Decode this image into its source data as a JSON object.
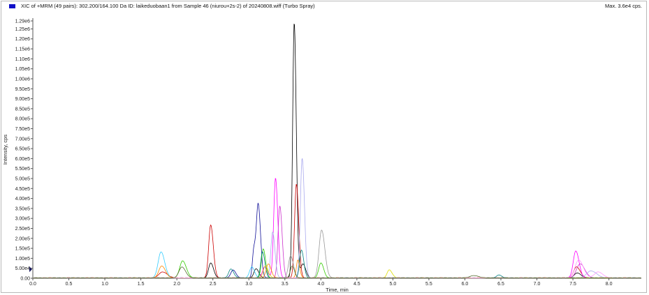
{
  "header": {
    "title": "XIC of +MRM (49 pairs): 302.200/164.100 Da ID: laikeduobaan1 from Sample 46 (niurou+2s-2) of 20240808.wiff (Turbo Spray)",
    "max_label": "Max. 3.6e4 cps."
  },
  "chart_data": {
    "type": "line",
    "xlabel": "Time, min",
    "ylabel": "Intensity, cps",
    "xlim": [
      0.0,
      8.45
    ],
    "ylim": [
      0,
      1290000
    ],
    "x_ticks": [
      0.0,
      0.5,
      1.0,
      1.5,
      2.0,
      2.5,
      3.0,
      3.5,
      4.0,
      4.5,
      5.0,
      5.5,
      6.0,
      6.5,
      7.0,
      7.5,
      8.0
    ],
    "x_tick_labels": [
      "0.0",
      "0.5",
      "1.0",
      "1.5",
      "2.0",
      "2.5",
      "3.0",
      "3.5",
      "4.0",
      "4.5",
      "5.0",
      "5.5",
      "6.0",
      "6.5",
      "7.0",
      "7.5",
      "8.0"
    ],
    "y_ticks": [
      0,
      50000,
      100000,
      150000,
      200000,
      250000,
      300000,
      350000,
      400000,
      450000,
      500000,
      550000,
      600000,
      650000,
      700000,
      750000,
      800000,
      850000,
      900000,
      950000,
      1000000,
      1050000,
      1100000,
      1150000,
      1200000,
      1250000,
      1290000
    ],
    "y_tick_labels": [
      "0.00",
      "5.00e4",
      "1.00e5",
      "1.50e5",
      "2.00e5",
      "2.50e5",
      "3.00e5",
      "3.50e5",
      "4.00e5",
      "4.50e5",
      "5.00e5",
      "5.50e5",
      "6.00e5",
      "6.50e5",
      "7.00e5",
      "7.50e5",
      "8.00e5",
      "8.50e5",
      "9.00e5",
      "9.50e5",
      "1.00e6",
      "1.05e6",
      "1.10e6",
      "1.15e6",
      "1.20e6",
      "1.25e6",
      "1.29e6"
    ],
    "grid": false,
    "series": [
      {
        "color": "#000000",
        "peaks": [
          [
            3.63,
            1280000,
            0.022
          ],
          [
            2.47,
            75000,
            0.03
          ],
          [
            3.1,
            45000,
            0.03
          ],
          [
            3.75,
            70000,
            0.03
          ],
          [
            7.56,
            25000,
            0.04
          ]
        ]
      },
      {
        "color": "#cc0000",
        "peaks": [
          [
            2.47,
            265000,
            0.028
          ],
          [
            3.66,
            470000,
            0.025
          ],
          [
            7.55,
            55000,
            0.04
          ],
          [
            1.8,
            30000,
            0.05
          ]
        ]
      },
      {
        "color": "#111199",
        "peaks": [
          [
            3.13,
            365000,
            0.025
          ],
          [
            3.07,
            140000,
            0.02
          ],
          [
            2.78,
            40000,
            0.03
          ]
        ]
      },
      {
        "color": "#ff00ff",
        "peaks": [
          [
            3.37,
            500000,
            0.025
          ],
          [
            7.54,
            135000,
            0.035
          ],
          [
            3.22,
            55000,
            0.03
          ]
        ]
      },
      {
        "color": "#cc33cc",
        "peaks": [
          [
            3.43,
            360000,
            0.025
          ],
          [
            7.6,
            70000,
            0.05
          ]
        ]
      },
      {
        "color": "#33ccff",
        "peaks": [
          [
            1.78,
            130000,
            0.04
          ],
          [
            3.04,
            55000,
            0.03
          ]
        ]
      },
      {
        "color": "#33cc00",
        "peaks": [
          [
            2.08,
            85000,
            0.04
          ],
          [
            3.2,
            145000,
            0.025
          ],
          [
            4.0,
            75000,
            0.03
          ]
        ]
      },
      {
        "color": "#999999",
        "peaks": [
          [
            4.01,
            240000,
            0.035
          ],
          [
            3.58,
            110000,
            0.03
          ]
        ]
      },
      {
        "color": "#aaaaee",
        "peaks": [
          [
            3.74,
            600000,
            0.025
          ],
          [
            3.33,
            230000,
            0.025
          ],
          [
            7.75,
            35000,
            0.06
          ]
        ]
      },
      {
        "color": "#008080",
        "peaks": [
          [
            2.75,
            45000,
            0.03
          ],
          [
            3.19,
            130000,
            0.025
          ],
          [
            3.73,
            140000,
            0.025
          ],
          [
            6.47,
            15000,
            0.03
          ]
        ]
      },
      {
        "color": "#ff8800",
        "peaks": [
          [
            3.27,
            70000,
            0.03
          ],
          [
            1.79,
            60000,
            0.04
          ],
          [
            3.68,
            90000,
            0.02
          ]
        ]
      },
      {
        "color": "#dddd00",
        "peaks": [
          [
            4.95,
            40000,
            0.03
          ],
          [
            3.23,
            60000,
            0.03
          ]
        ]
      },
      {
        "color": "#ff99ff",
        "peaks": [
          [
            7.58,
            90000,
            0.05
          ],
          [
            7.85,
            30000,
            0.05
          ]
        ]
      },
      {
        "color": "#556b2f",
        "peaks": [
          [
            6.12,
            12000,
            0.05
          ],
          [
            2.07,
            55000,
            0.04
          ],
          [
            3.6,
            60000,
            0.025
          ]
        ]
      }
    ]
  }
}
